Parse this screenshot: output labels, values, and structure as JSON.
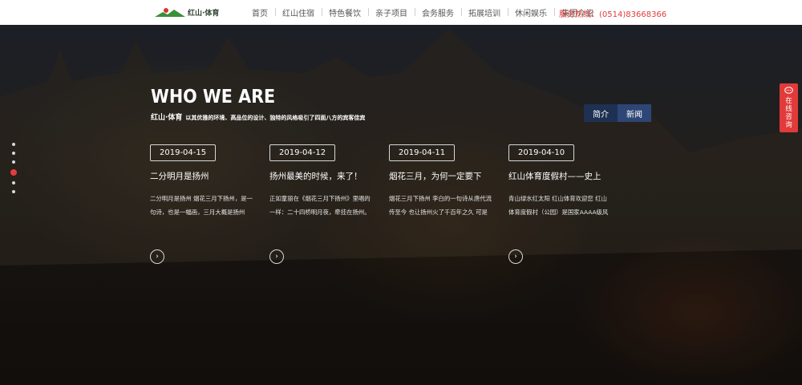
{
  "header": {
    "logo_text": "红山·体育",
    "nav": [
      "首页",
      "红山住宿",
      "特色餐饮",
      "亲子项目",
      "会务服务",
      "拓展培训",
      "休闲娱乐",
      "集团介绍"
    ],
    "hotline": "服务热线：(0514)83668366"
  },
  "hero": {
    "title": "WHO WE ARE",
    "brand": "红山·体育",
    "slogan": "以其优雅的环境、高品位的设计、独特的风格吸引了四面八方的宾客佳宾",
    "tabs": [
      "简介",
      "新闻"
    ],
    "dots_count": 6,
    "active_dot": 3
  },
  "news": [
    {
      "date": "2019-04-15",
      "title": "二分明月是扬州",
      "desc": "二分明月是扬州 烟花三月下扬州，是一句诗，也是一幅画，三月大概是扬州最..."
    },
    {
      "date": "2019-04-12",
      "title": "扬州最美的时候，来了！",
      "desc": "正如童丽在《烟花三月下扬州》里唱的一样：二十四桥明月夜，牵挂在扬州。扬..."
    },
    {
      "date": "2019-04-11",
      "title": "烟花三月，为何一定要下",
      "desc": "烟花三月下扬州 李白的一句诗从唐代流传至今 也让扬州火了千百年之久 可是也..."
    },
    {
      "date": "2019-04-10",
      "title": "红山体育度假村——史上",
      "desc": "青山绿水红太阳 红山体育欢迎您 红山体育度假村（公园）是国家AAAA级风景区，..."
    }
  ],
  "arrow_symbol": "›",
  "consult": {
    "label": "在线咨询",
    "icon": "chat-bubble-icon"
  },
  "colors": {
    "accent": "#e23a3a",
    "tab_a": "#1f3152",
    "tab_b": "#2d4675"
  }
}
